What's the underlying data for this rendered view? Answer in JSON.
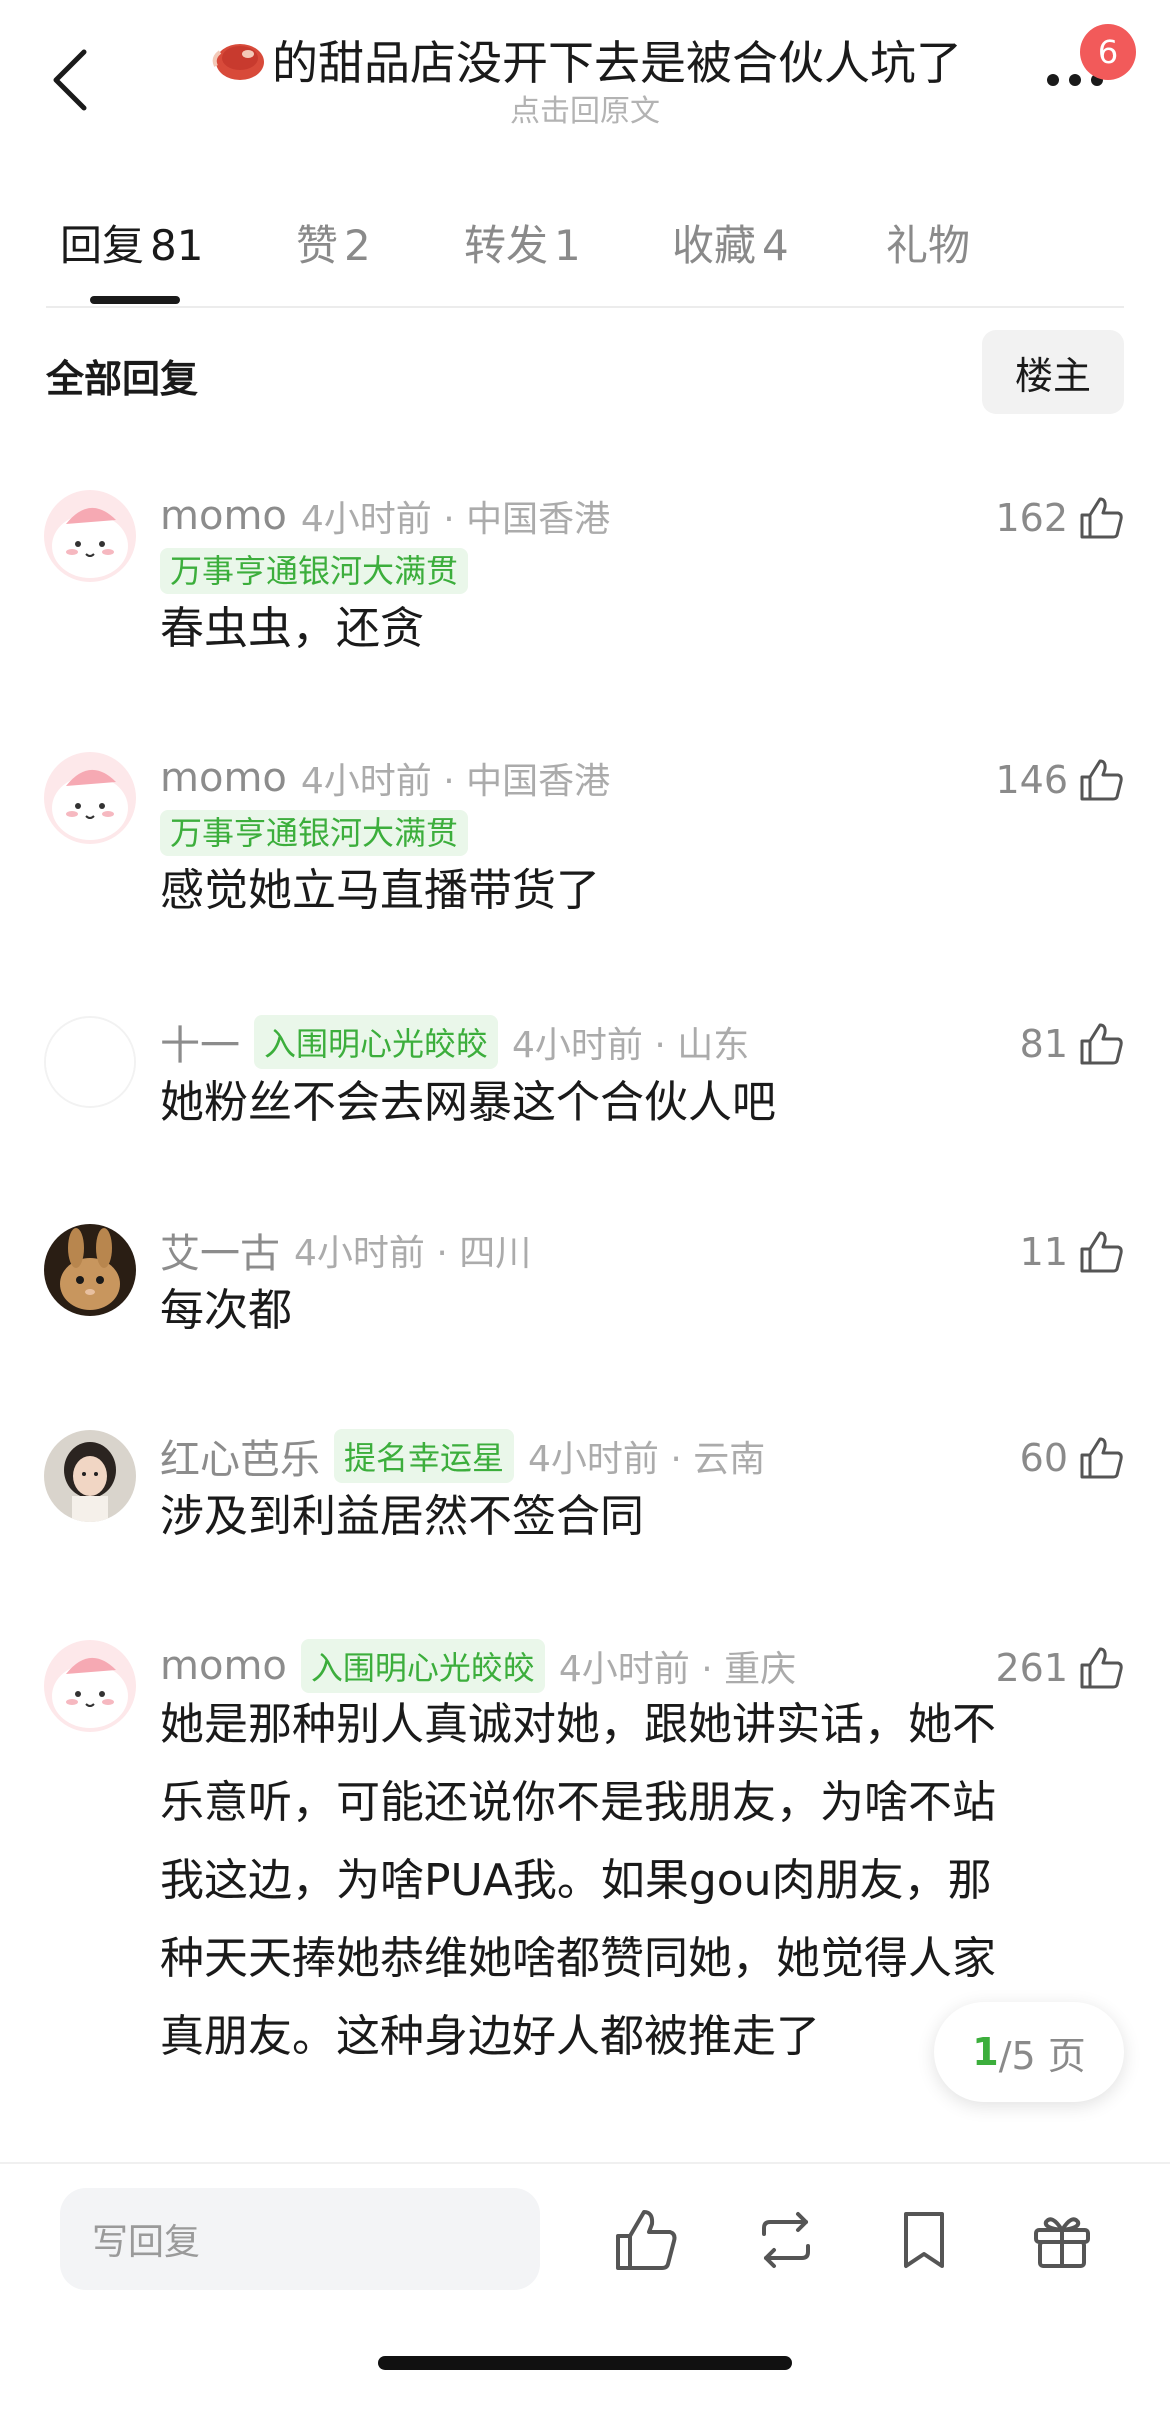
{
  "header": {
    "title": "的甜品店没开下去是被合伙人坑了",
    "title_emoji": "steak-emoji",
    "subtitle": "点击回原文",
    "notification_badge": "6"
  },
  "tabs": [
    {
      "label": "回复",
      "count": "81",
      "active": true
    },
    {
      "label": "赞",
      "count": "2",
      "active": false
    },
    {
      "label": "转发",
      "count": "1",
      "active": false
    },
    {
      "label": "收藏",
      "count": "4",
      "active": false
    },
    {
      "label": "礼物",
      "count": "",
      "active": false
    }
  ],
  "filter": {
    "label": "全部回复",
    "op_button": "楼主"
  },
  "comments": [
    {
      "username": "momo",
      "time": "4小时前 · 中国香港",
      "tag": "万事亨通银河大满贯",
      "text": "春虫虫，还贪",
      "likes": "162",
      "avatar": "pink-creature-avatar"
    },
    {
      "username": "momo",
      "time": "4小时前 · 中国香港",
      "tag": "万事亨通银河大满贯",
      "text": "感觉她立马直播带货了",
      "likes": "146",
      "avatar": "pink-creature-avatar"
    },
    {
      "username": "十一",
      "time": "4小时前 · 山东",
      "tag": "入围明心光皎皎",
      "text": "她粉丝不会去网暴这个合伙人吧",
      "likes": "81",
      "avatar": "blank-avatar"
    },
    {
      "username": "艾一古",
      "time": "4小时前 · 四川",
      "tag": "",
      "text": "每次都",
      "likes": "11",
      "avatar": "rabbit-avatar"
    },
    {
      "username": "红心芭乐",
      "time": "4小时前 · 云南",
      "tag": "提名幸运星",
      "text": "涉及到利益居然不签合同",
      "likes": "60",
      "avatar": "girl-photo-avatar"
    },
    {
      "username": "momo",
      "time": "4小时前 · 重庆",
      "tag": "入围明心光皎皎",
      "text_lines": [
        "她是那种别人真诚对她，跟她讲实话，她不",
        "乐意听，可能还说你不是我朋友，为啥不站",
        "我这边，为啥PUA我。如果gou肉朋友，那",
        "种天天捧她恭维她啥都赞同她，她觉得人家",
        "真朋友。这种身边好人都被推走了"
      ],
      "likes": "261",
      "avatar": "pink-creature-avatar"
    }
  ],
  "pager": {
    "current": "1",
    "total": "/5 页"
  },
  "bottom_bar": {
    "reply_placeholder": "写回复",
    "icons": [
      "thumbs-up-icon",
      "repost-icon",
      "bookmark-icon",
      "gift-icon"
    ]
  },
  "colors": {
    "tag_green": "#3cae3c",
    "tag_bg": "#eaf7ea",
    "badge_red": "#f25a5a",
    "text_primary": "#1a1a1a",
    "text_muted": "#8a8a8a"
  }
}
